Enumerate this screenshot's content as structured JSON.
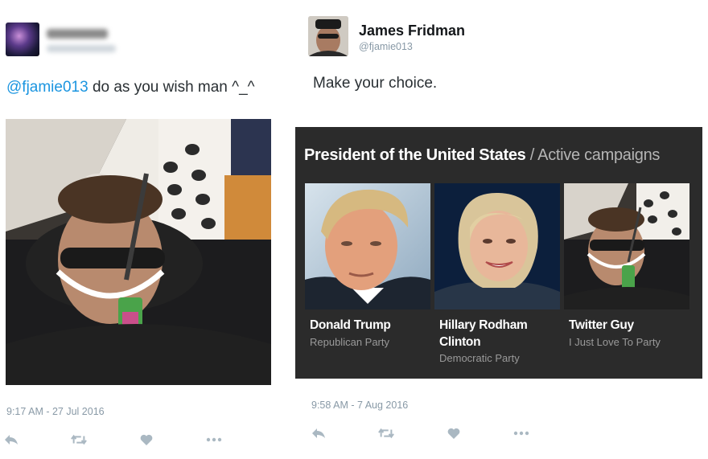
{
  "left_tweet": {
    "mention": "@fjamie013",
    "text": " do as you wish man ^_^",
    "timestamp": "9:17 AM - 27 Jul 2016"
  },
  "right_tweet": {
    "name": "James Fridman",
    "handle": "@fjamie013",
    "text": "Make your choice.",
    "timestamp": "9:58 AM - 7 Aug 2016",
    "card": {
      "title": "President of the United States",
      "separator": " / ",
      "subtitle": "Active campaigns",
      "candidates": [
        {
          "name": "Donald Trump",
          "party": "Republican Party"
        },
        {
          "name": "Hillary Rodham Clinton",
          "party": "Democratic Party"
        },
        {
          "name": "Twitter Guy",
          "party": "I Just Love To Party"
        }
      ]
    }
  },
  "actions": [
    "reply-icon",
    "retweet-icon",
    "like-icon",
    "more-icon"
  ],
  "colors": {
    "link": "#1b95e0",
    "meta": "#8899a6",
    "card_bg": "#2b2b2b",
    "icon": "#aab8c2"
  }
}
